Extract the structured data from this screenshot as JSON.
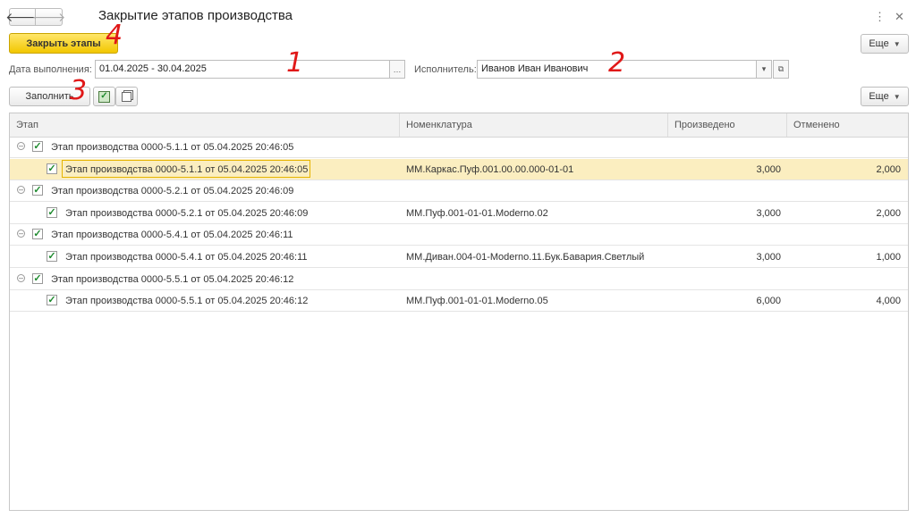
{
  "header": {
    "title": "Закрытие этапов производства",
    "back_glyph": "🡐",
    "forward_glyph": "🡒",
    "more_glyph": "⋮",
    "close_glyph": "✕"
  },
  "toolbar": {
    "close_stages_label": "Закрыть этапы",
    "more_label": "Еще"
  },
  "filters": {
    "date_label": "Дата выполнения:",
    "date_value": "01.04.2025 - 30.04.2025",
    "executor_label": "Исполнитель:",
    "executor_value": "Иванов Иван Иванович"
  },
  "table_toolbar": {
    "fill_label": "Заполнить",
    "more_label": "Еще"
  },
  "annotations": [
    "1",
    "2",
    "3",
    "4"
  ],
  "table": {
    "columns": [
      "Этап",
      "Номенклатура",
      "Произведено",
      "Отменено"
    ],
    "rows": [
      {
        "level": 0,
        "checked": true,
        "stage": "Этап производства 0000-5.1.1 от 05.04.2025 20:46:05",
        "nomenclature": "",
        "produced": "",
        "cancelled": ""
      },
      {
        "level": 1,
        "checked": true,
        "stage": "Этап производства 0000-5.1.1 от 05.04.2025 20:46:05",
        "nomenclature": "ММ.Каркас.Пуф.001.00.00.000-01-01",
        "produced": "3,000",
        "cancelled": "2,000",
        "selected": true
      },
      {
        "level": 0,
        "checked": true,
        "stage": "Этап производства 0000-5.2.1 от 05.04.2025 20:46:09",
        "nomenclature": "",
        "produced": "",
        "cancelled": ""
      },
      {
        "level": 1,
        "checked": true,
        "stage": "Этап производства 0000-5.2.1 от 05.04.2025 20:46:09",
        "nomenclature": "ММ.Пуф.001-01-01.Moderno.02",
        "produced": "3,000",
        "cancelled": "2,000"
      },
      {
        "level": 0,
        "checked": true,
        "stage": "Этап производства 0000-5.4.1 от 05.04.2025 20:46:11",
        "nomenclature": "",
        "produced": "",
        "cancelled": ""
      },
      {
        "level": 1,
        "checked": true,
        "stage": "Этап производства 0000-5.4.1 от 05.04.2025 20:46:11",
        "nomenclature": "ММ.Диван.004-01-Moderno.11.Бук.Бавария.Светлый",
        "produced": "3,000",
        "cancelled": "1,000"
      },
      {
        "level": 0,
        "checked": true,
        "stage": "Этап производства 0000-5.5.1 от 05.04.2025 20:46:12",
        "nomenclature": "",
        "produced": "",
        "cancelled": ""
      },
      {
        "level": 1,
        "checked": true,
        "stage": "Этап производства 0000-5.5.1 от 05.04.2025 20:46:12",
        "nomenclature": "ММ.Пуф.001-01-01.Moderno.05",
        "produced": "6,000",
        "cancelled": "4,000"
      }
    ]
  }
}
